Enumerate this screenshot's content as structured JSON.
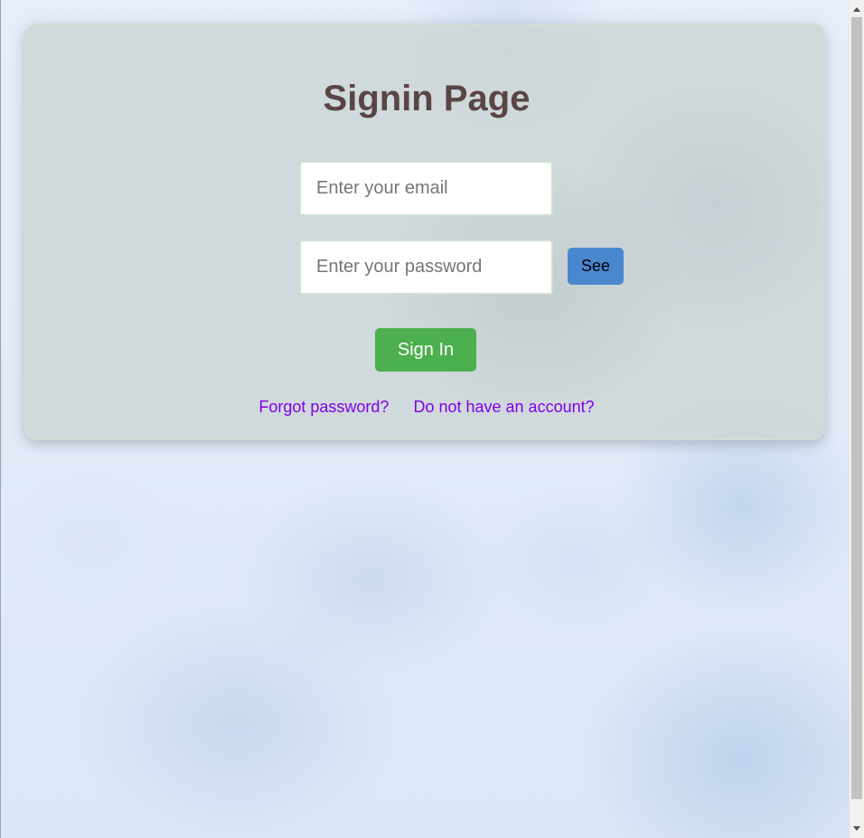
{
  "page": {
    "title": "Signin Page"
  },
  "form": {
    "email_placeholder": "Enter your email",
    "email_value": "",
    "password_placeholder": "Enter your password",
    "password_value": "",
    "see_label": "See",
    "signin_label": "Sign In"
  },
  "links": {
    "forgot_password": "Forgot password?",
    "no_account": "Do not have an account?"
  },
  "colors": {
    "title": "#5a4545",
    "see_button": "#4a87cf",
    "signin_button": "#4caf50",
    "link": "#7f00e8"
  },
  "icons": {
    "scroll_up": "triangle-up-icon",
    "scroll_down": "triangle-down-icon"
  }
}
